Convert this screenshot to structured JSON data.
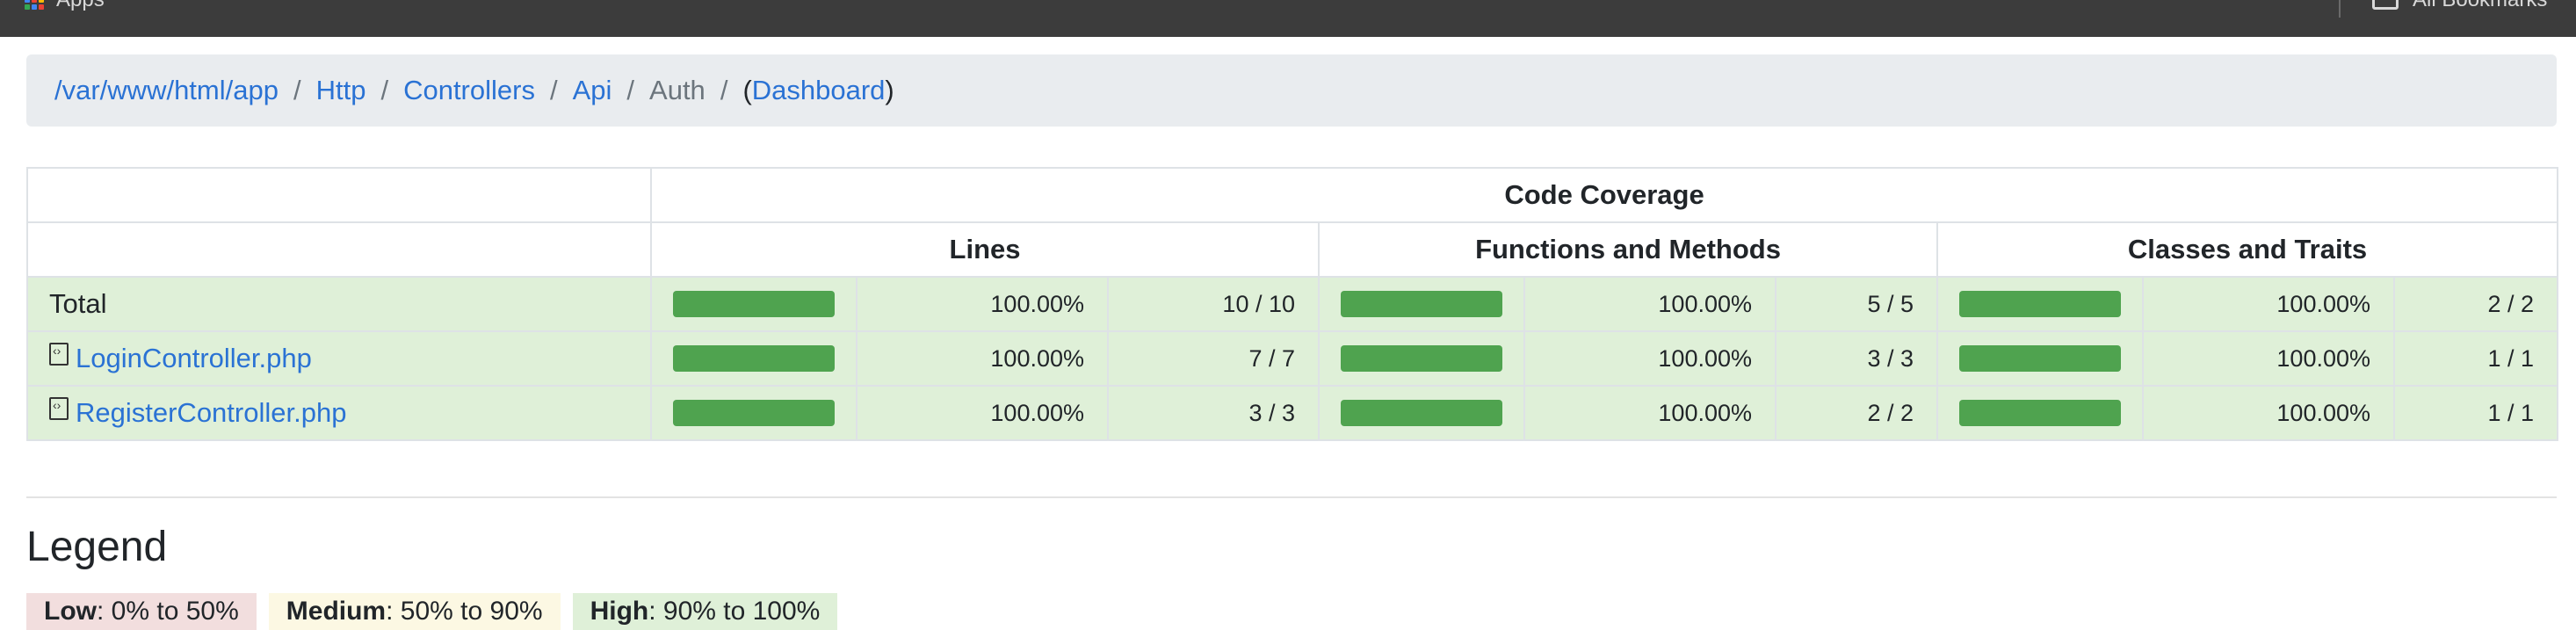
{
  "bookmarks_bar": {
    "apps_label": "Apps",
    "all_bookmarks_label": "All Bookmarks"
  },
  "breadcrumb": {
    "items": [
      "/var/www/html/app",
      "Http",
      "Controllers",
      "Api"
    ],
    "active": "Auth",
    "dashboard_label": "Dashboard",
    "separator": "/"
  },
  "table": {
    "header_coverage": "Code Coverage",
    "group_headers": [
      "Lines",
      "Functions and Methods",
      "Classes and Traits"
    ],
    "rows": [
      {
        "name": "Total",
        "is_link": false,
        "lines": {
          "pct": "100.00%",
          "ratio": "10 / 10",
          "fill": 1.0
        },
        "methods": {
          "pct": "100.00%",
          "ratio": "5 / 5",
          "fill": 1.0
        },
        "classes": {
          "pct": "100.00%",
          "ratio": "2 / 2",
          "fill": 1.0
        }
      },
      {
        "name": "LoginController.php",
        "is_link": true,
        "lines": {
          "pct": "100.00%",
          "ratio": "7 / 7",
          "fill": 1.0
        },
        "methods": {
          "pct": "100.00%",
          "ratio": "3 / 3",
          "fill": 1.0
        },
        "classes": {
          "pct": "100.00%",
          "ratio": "1 / 1",
          "fill": 1.0
        }
      },
      {
        "name": "RegisterController.php",
        "is_link": true,
        "lines": {
          "pct": "100.00%",
          "ratio": "3 / 3",
          "fill": 1.0
        },
        "methods": {
          "pct": "100.00%",
          "ratio": "2 / 2",
          "fill": 1.0
        },
        "classes": {
          "pct": "100.00%",
          "ratio": "1 / 1",
          "fill": 1.0
        }
      }
    ]
  },
  "legend": {
    "title": "Legend",
    "low": {
      "label": "Low",
      "range": ": 0% to 50%"
    },
    "medium": {
      "label": "Medium",
      "range": ": 50% to 90%"
    },
    "high": {
      "label": "High",
      "range": ": 90% to 100%"
    }
  },
  "colors": {
    "success_row": "#dff0d8",
    "bar_fill": "#4fa34f",
    "link": "#2a72d4",
    "low": "#f2dede",
    "medium": "#fcf8e3",
    "high": "#dff0d8"
  }
}
